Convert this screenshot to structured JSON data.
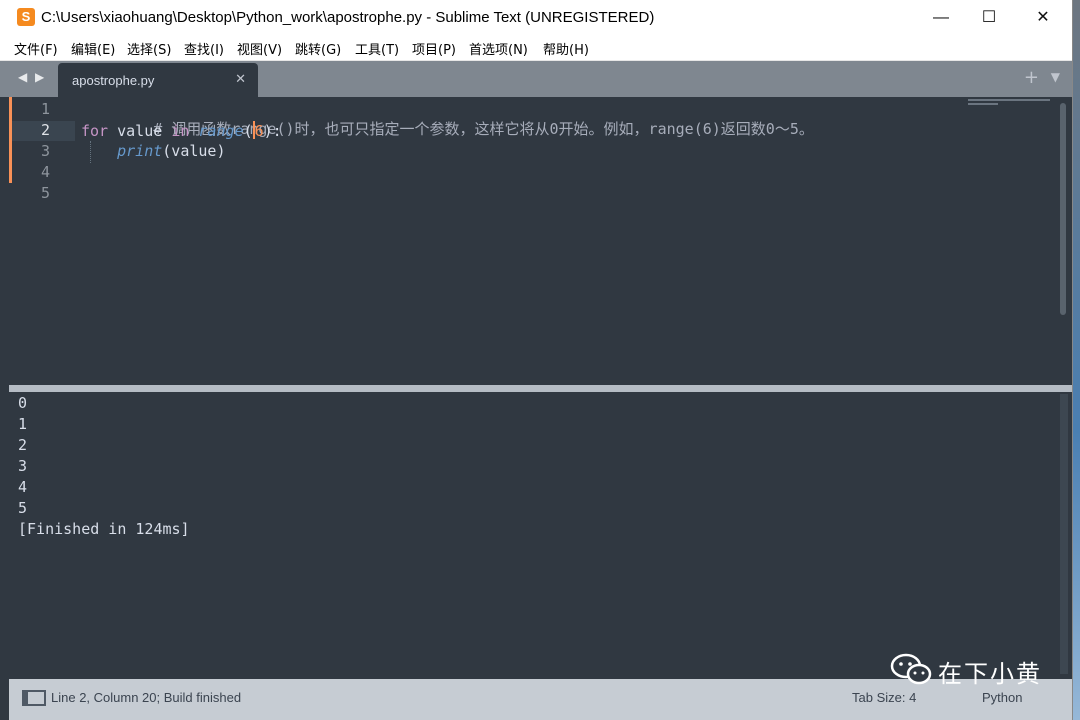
{
  "window": {
    "title": "C:\\Users\\xiaohuang\\Desktop\\Python_work\\apostrophe.py - Sublime Text (UNREGISTERED)",
    "app_icon": "S",
    "controls": {
      "minimize": "—",
      "maximize": "☐",
      "close": "✕"
    }
  },
  "menu": [
    "文件(F)",
    "编辑(E)",
    "选择(S)",
    "查找(I)",
    "视图(V)",
    "跳转(G)",
    "工具(T)",
    "项目(P)",
    "首选项(N)",
    "帮助(H)"
  ],
  "tabs": {
    "nav_left": "◀",
    "nav_right": "▶",
    "active": {
      "label": "apostrophe.py",
      "close": "✕"
    },
    "add": "+",
    "menu": "▼"
  },
  "editor": {
    "line_numbers": [
      "1",
      "2",
      "3",
      "4",
      "5"
    ],
    "active_line": 2,
    "lines": {
      "l1_comment": "# 调用函数range()时，也可只指定一个参数，这样它将从0开始。例如，range(6)返回数0～5。",
      "l2_for": "for",
      "l2_var": " value ",
      "l2_in": "in",
      "l2_sp": " ",
      "l2_fn": "range",
      "l2_open": "(",
      "l2_num": "6",
      "l2_close": "):",
      "l3_indent": "    ",
      "l3_fn": "print",
      "l3_args": "(value)"
    }
  },
  "output": {
    "lines": [
      "0",
      "1",
      "2",
      "3",
      "4",
      "5",
      "[Finished in 124ms]"
    ]
  },
  "status": {
    "left": "Line 2, Column 20; Build finished",
    "tab_size": "Tab Size: 4",
    "syntax": "Python"
  },
  "watermark": {
    "text": "在下小黄",
    "icon": "wechat-icon"
  },
  "colors": {
    "background": "#303841",
    "comment": "#a7adba",
    "keyword": "#c594c5",
    "function": "#6699cc",
    "number": "#f99157",
    "statusbar": "#c6ccd3"
  }
}
